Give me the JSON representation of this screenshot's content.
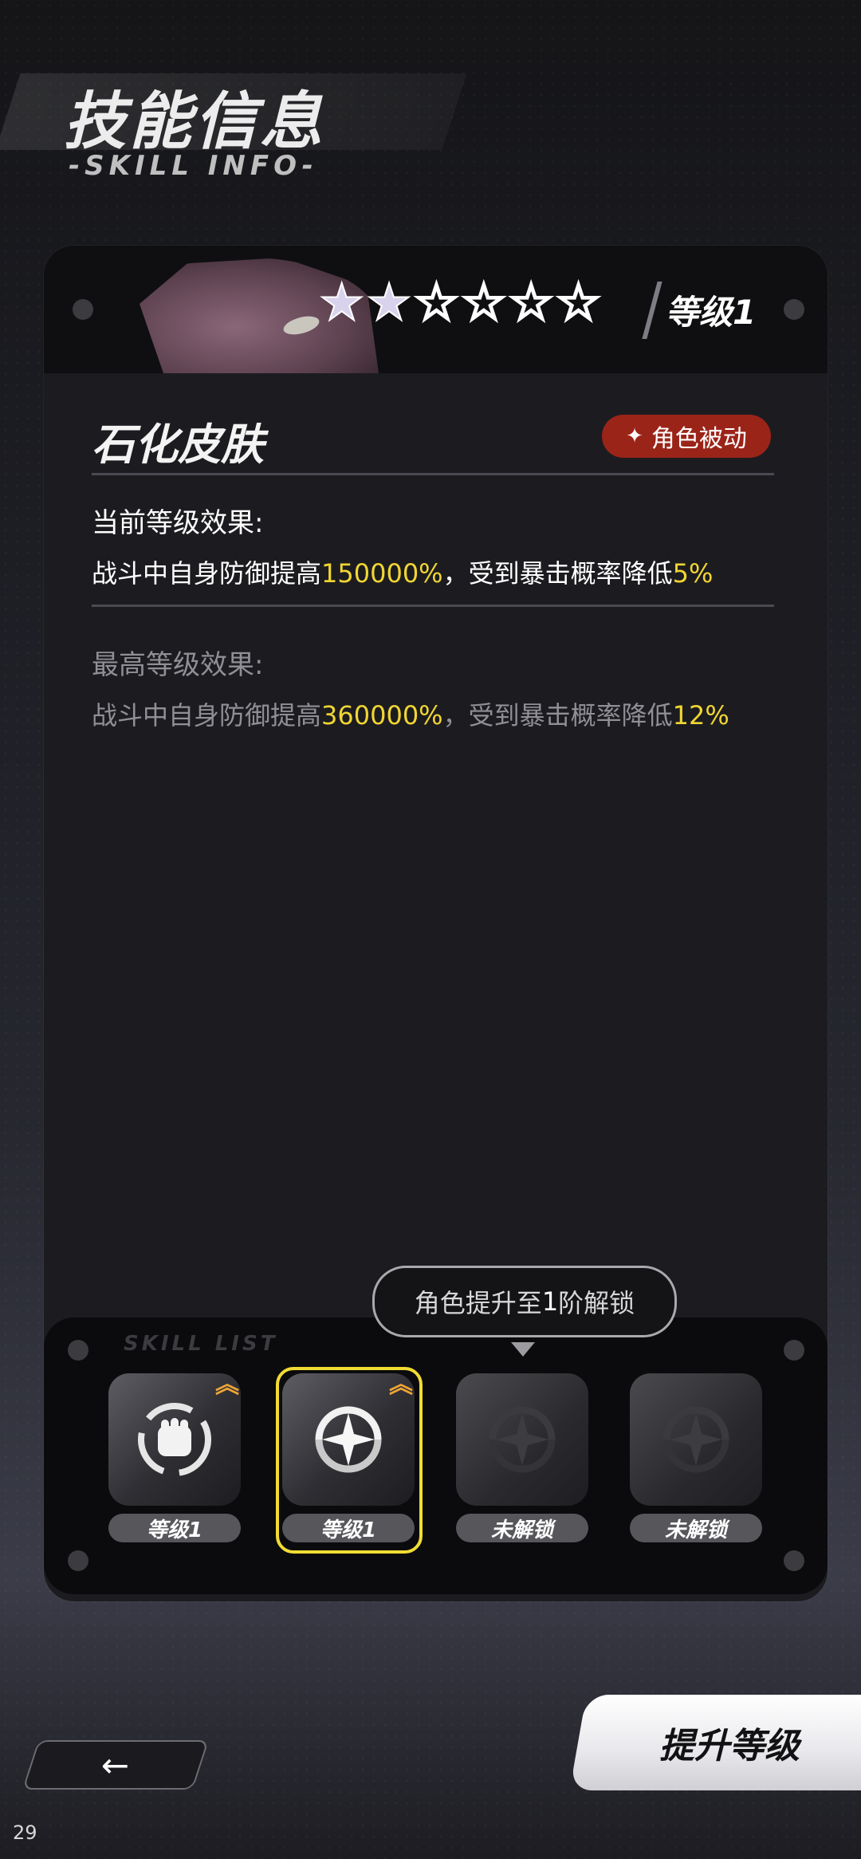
{
  "header": {
    "title": "技能信息",
    "subtitle": "-SKILL INFO-"
  },
  "card": {
    "stars_filled": 2,
    "stars_total": 6,
    "level_label": "等级1",
    "skill_name": "石化皮肤",
    "badge_label": "角色被动",
    "current_title": "当前等级效果:",
    "current_prefix": "战斗中自身防御提高",
    "current_value1": "150000%",
    "current_mid": "，受到暴击概率降低",
    "current_value2": "5%",
    "max_title": "最高等级效果:",
    "max_prefix": "战斗中自身防御提高",
    "max_value1": "360000%",
    "max_mid": "，受到暴击概率降低",
    "max_value2": "12%"
  },
  "tooltip": {
    "prefix": "角色提升至",
    "num": "1",
    "suffix": "阶解锁"
  },
  "slots_panel": {
    "tag": "SKILL LIST"
  },
  "slots": [
    {
      "label": "等级1",
      "icon": "fist-icon",
      "upgrade_icon": "double-chevron-up-icon",
      "state": "unlocked"
    },
    {
      "label": "等级1",
      "icon": "shuriken-icon",
      "upgrade_icon": "double-chevron-up-icon",
      "state": "selected"
    },
    {
      "label": "未解锁",
      "icon": "shuriken-icon",
      "state": "locked"
    },
    {
      "label": "未解锁",
      "icon": "shuriken-icon",
      "state": "locked"
    }
  ],
  "buttons": {
    "back_icon": "back-arrow-icon",
    "upgrade_label": "提升等级"
  },
  "page_number": "29",
  "colors": {
    "highlight": "#f1d633",
    "badge": "#9b2419",
    "selected_frame": "#f2dc33",
    "upgrade_chevron": "#f0a535"
  }
}
